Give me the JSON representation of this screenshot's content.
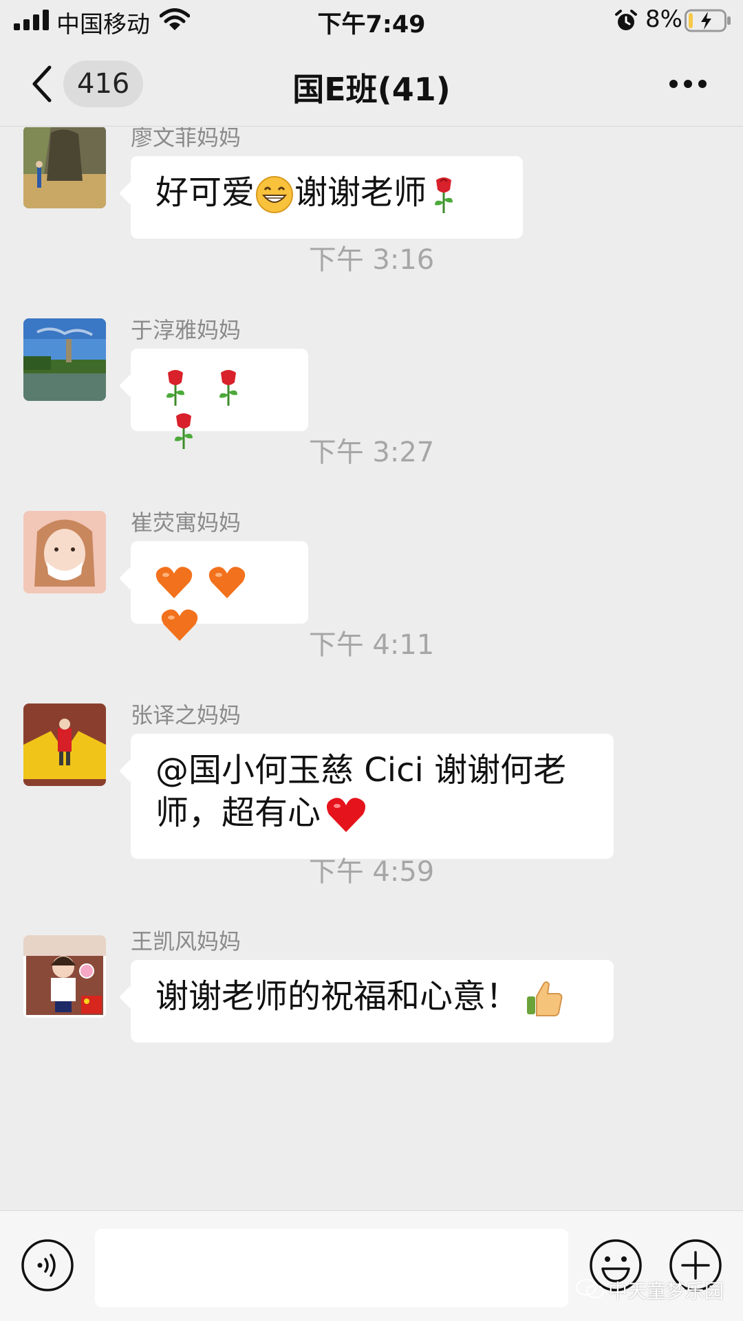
{
  "status_bar": {
    "carrier": "中国移动",
    "time": "下午7:49",
    "battery": "8%"
  },
  "nav": {
    "unread_count": "416",
    "title": "国E班(41)"
  },
  "messages": [
    {
      "sender": "廖文菲妈妈",
      "text_before": "好可爱",
      "text_middle": "谢谢老师"
    },
    {
      "timestamp": "下午 3:16"
    },
    {
      "sender": "于淳雅妈妈"
    },
    {
      "timestamp": "下午 3:27"
    },
    {
      "sender": "崔荧寓妈妈"
    },
    {
      "timestamp": "下午 4:11"
    },
    {
      "sender": "张译之妈妈",
      "line1": "@国小何玉慈 Cici 谢谢何老",
      "line2": "师，超有心"
    },
    {
      "timestamp": "下午 4:59"
    },
    {
      "sender": "王凯风妈妈",
      "text": "谢谢老师的祝福和心意！"
    }
  ],
  "watermark": "中天童梦乐园",
  "icons": {
    "signal": "signal-bars-icon",
    "wifi": "wifi-icon",
    "alarm": "alarm-icon",
    "battery": "battery-charging-icon",
    "back": "chevron-left-icon",
    "more": "more-dots-icon",
    "voice": "voice-icon",
    "emoji": "emoji-icon",
    "plus": "plus-icon"
  },
  "colors": {
    "background": "#ededed",
    "bubble": "#ffffff",
    "timestamp": "#a6a6a6",
    "sender": "#8a8a8a",
    "battery_low": "#f7c948"
  }
}
